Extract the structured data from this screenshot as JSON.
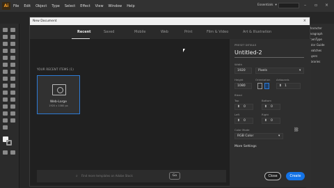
{
  "menubar": {
    "logo": "Ai",
    "items": [
      "File",
      "Edit",
      "Object",
      "Type",
      "Select",
      "Effect",
      "View",
      "Window",
      "Help"
    ],
    "workspace": "Essentials"
  },
  "right_panel": {
    "items": [
      "Character",
      "Paragraph",
      "OpenType",
      "Color Guide",
      "Swatches",
      "Layers",
      "Libraries"
    ]
  },
  "dialog": {
    "title": "New Document",
    "close_icon": "×",
    "tabs": [
      "Recent",
      "Saved",
      "Mobile",
      "Web",
      "Print",
      "Film & Video",
      "Art & Illustration"
    ],
    "recent_heading": "YOUR RECENT ITEMS (1)",
    "recent_item": {
      "name": "Web-Large",
      "dims": "1920 x 1080 px"
    },
    "template_search_placeholder": "Find more templates on Adobe Stock",
    "go_label": "Go",
    "details": {
      "heading": "PRESET DETAILS",
      "doc_name": "Untitled-2",
      "width_label": "Width",
      "width_value": "1920",
      "units_value": "Pixels",
      "height_label": "Height",
      "height_value": "1080",
      "orientation_label": "Orientation",
      "artboards_label": "Artboards",
      "artboards_value": "1",
      "bleed_label": "Bleed",
      "top_label": "Top",
      "top_value": "0",
      "bottom_label": "Bottom",
      "bottom_value": "0",
      "left_label": "Left",
      "left_value": "0",
      "right_label": "Right",
      "right_value": "0",
      "color_mode_label": "Color Mode",
      "color_mode_value": "RGB Color",
      "more_settings": "More Settings"
    },
    "close_label": "Close",
    "create_label": "Create"
  },
  "colors": {
    "accent": "#1473e6",
    "highlight": "#2d7bd6"
  }
}
